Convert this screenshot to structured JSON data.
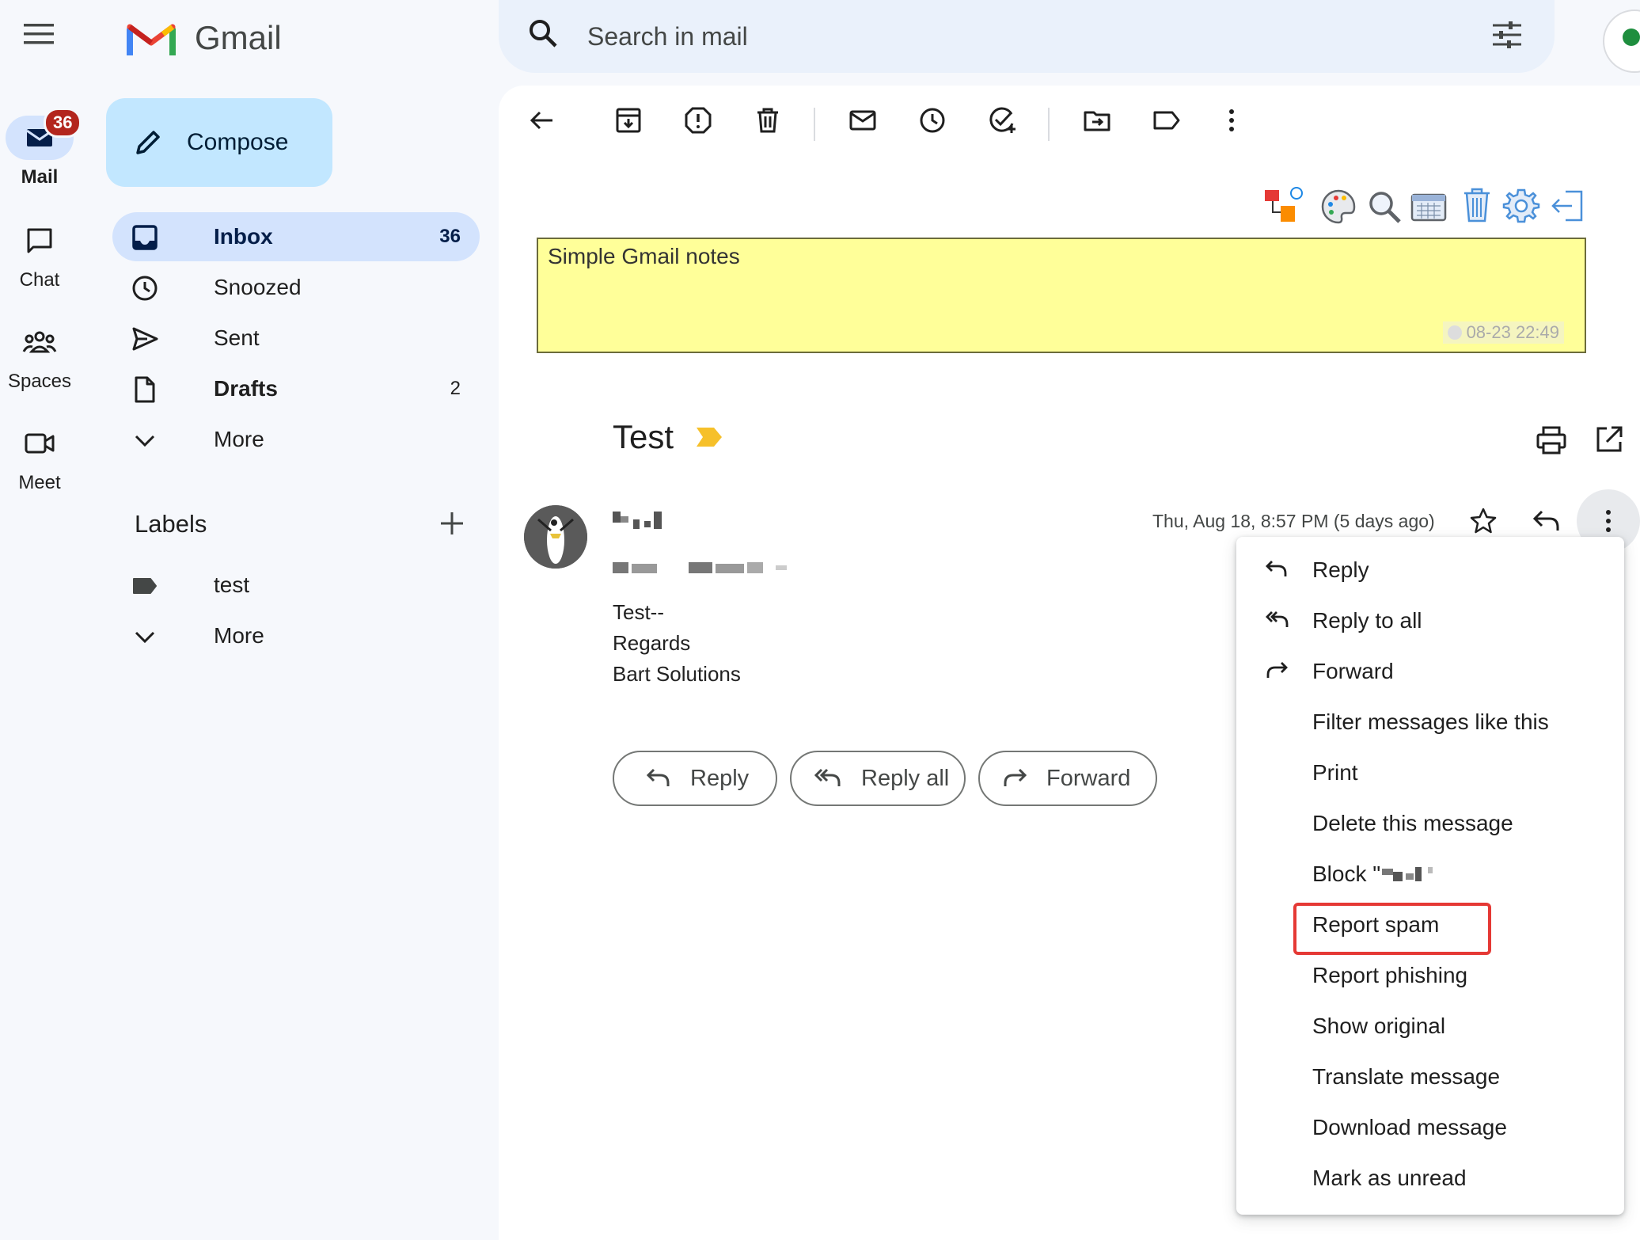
{
  "app": {
    "name": "Gmail"
  },
  "rail": {
    "mail": {
      "label": "Mail",
      "badge": "36"
    },
    "chat": {
      "label": "Chat"
    },
    "spaces": {
      "label": "Spaces"
    },
    "meet": {
      "label": "Meet"
    }
  },
  "compose": {
    "label": "Compose"
  },
  "nav": {
    "items": [
      {
        "label": "Inbox",
        "count": "36"
      },
      {
        "label": "Snoozed",
        "count": ""
      },
      {
        "label": "Sent",
        "count": ""
      },
      {
        "label": "Drafts",
        "count": "2"
      },
      {
        "label": "More",
        "count": ""
      }
    ],
    "labels_heading": "Labels",
    "labels": [
      {
        "label": "test"
      }
    ],
    "labels_more": "More"
  },
  "search": {
    "placeholder": "Search in mail"
  },
  "note": {
    "title": "Simple Gmail notes",
    "timestamp": "08-23 22:49"
  },
  "message": {
    "subject": "Test",
    "date": "Thu, Aug 18, 8:57 PM (5 days ago)",
    "body": [
      "Test--",
      "Regards",
      "Bart Solutions"
    ]
  },
  "actions": {
    "reply": "Reply",
    "reply_all": "Reply all",
    "forward": "Forward"
  },
  "menu": {
    "items": [
      "Reply",
      "Reply to all",
      "Forward",
      "Filter messages like this",
      "Print",
      "Delete this message",
      "Block \"",
      "Report spam",
      "Report phishing",
      "Show original",
      "Translate message",
      "Download message",
      "Mark as unread"
    ],
    "highlighted": "Report spam"
  },
  "colors": {
    "accent": "#0b57d0",
    "active_nav": "#d3e3fd",
    "compose": "#c2e7ff",
    "badge": "#b3261e",
    "note_bg": "#ffff99",
    "highlight": "#e53935"
  }
}
